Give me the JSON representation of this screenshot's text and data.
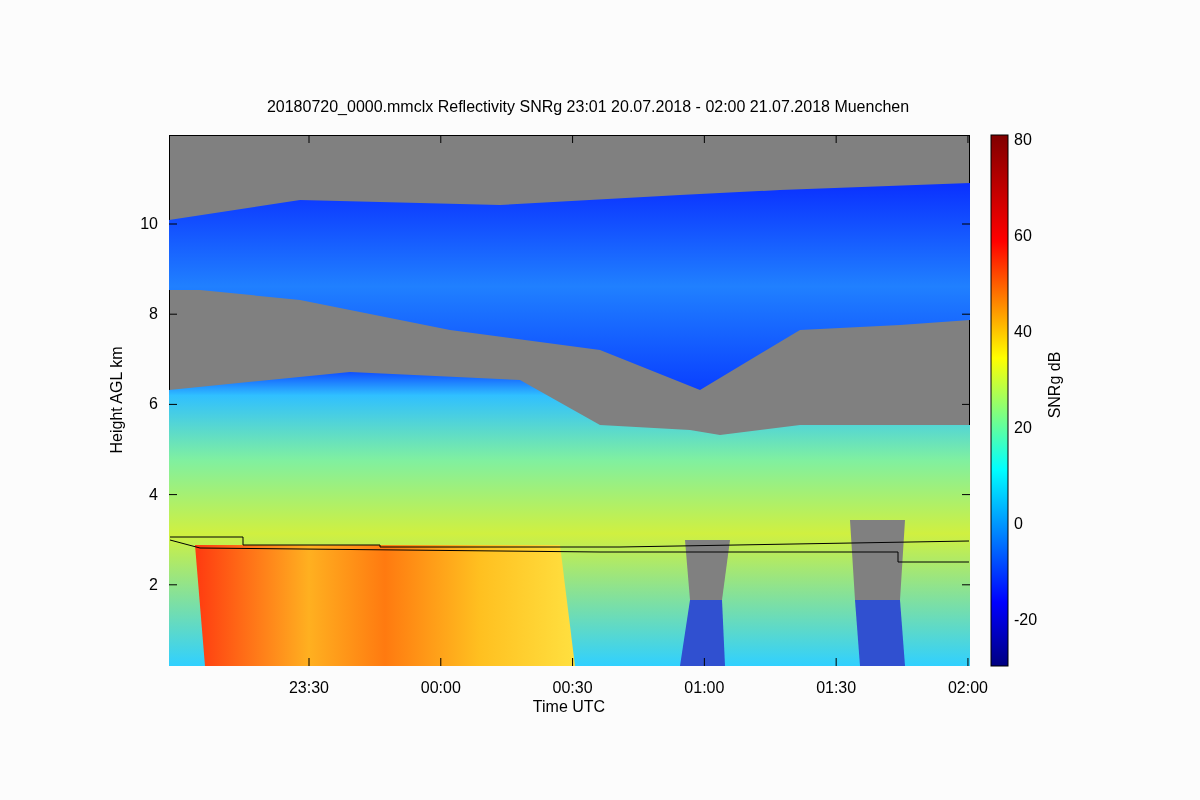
{
  "title": "20180720_0000.mmclx Reflectivity SNRg   23:01 20.07.2018 - 02:00 21.07.2018 Muenchen",
  "plot": {
    "ylabel": "Height AGL km",
    "xlabel": "Time UTC",
    "yticks": [
      "10",
      "8",
      "6",
      "4",
      "2"
    ],
    "xticks": [
      "23:30",
      "00:00",
      "00:30",
      "01:00",
      "01:30",
      "02:00"
    ]
  },
  "colorbar": {
    "label": "SNRg dB",
    "ticks": [
      "80",
      "60",
      "40",
      "20",
      "0",
      "-20"
    ]
  }
}
